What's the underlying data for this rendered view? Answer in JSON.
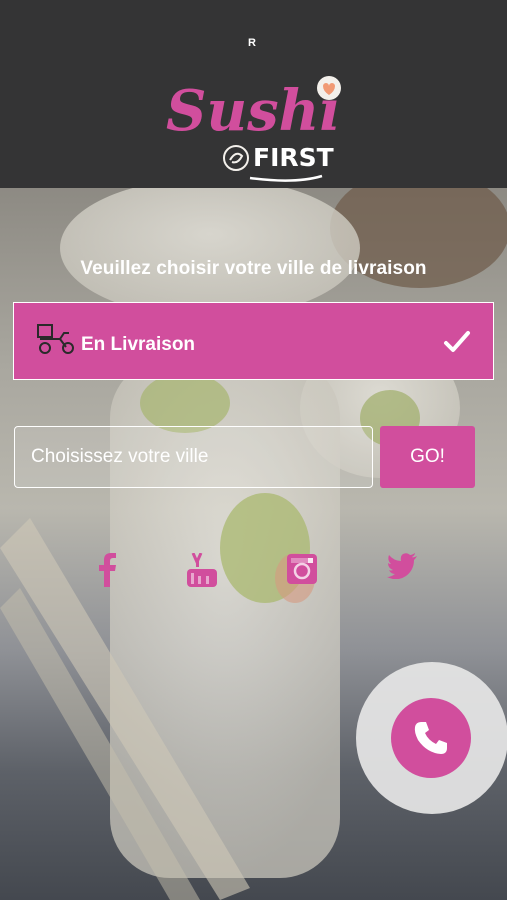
{
  "brand": {
    "registered_mark": "R",
    "logo_word_1": "Sushi",
    "logo_word_2": "FIRST"
  },
  "headline": "Veuillez choisir votre ville de livraison",
  "delivery_mode": {
    "label": "En Livraison",
    "selected": true
  },
  "city_search": {
    "placeholder": "Choisissez votre ville",
    "value": ""
  },
  "go_button": "GO!",
  "social": [
    "facebook-icon",
    "youtube-icon",
    "instagram-icon",
    "twitter-icon"
  ],
  "colors": {
    "accent": "#d14e9d",
    "header": "#343435"
  }
}
